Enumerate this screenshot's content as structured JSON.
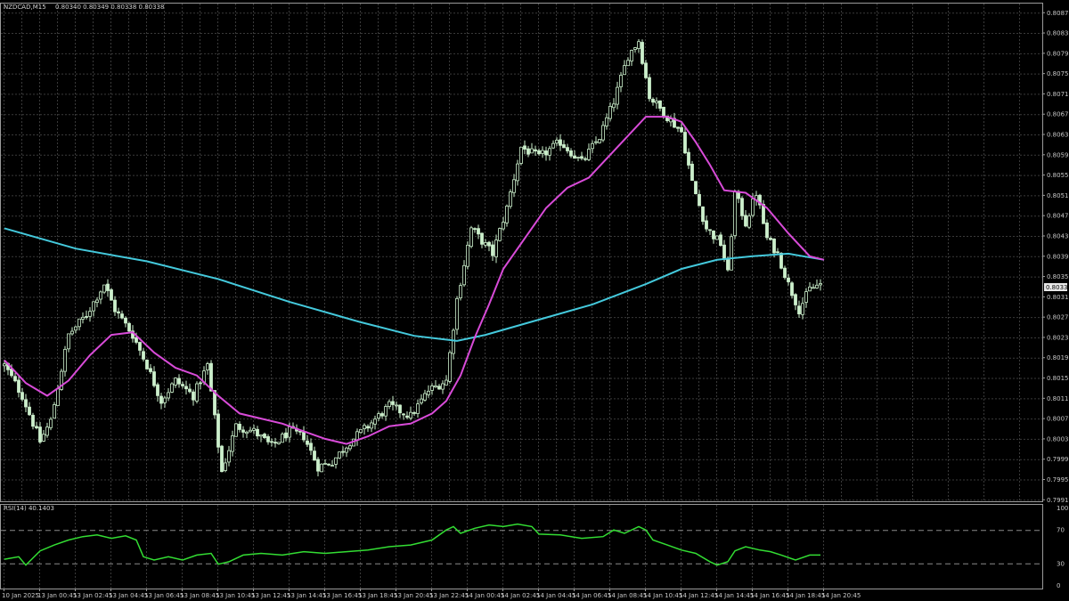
{
  "header": {
    "symbol_info": "NZDCAD,M15",
    "ohlc": "0.80340 0.80349 0.80338 0.80338"
  },
  "rsi_header": "RSI(14) 40.1403",
  "current_price_label": "0.80338",
  "colors": {
    "background": "#000000",
    "grid": "#3a3a3a",
    "frame": "#9a9a9a",
    "candle": "#ccf0cc",
    "ma_fast": "#d84bd8",
    "ma_slow": "#44c9dc",
    "rsi": "#33dd33"
  },
  "chart_data": {
    "type": "candlestick",
    "price_axis_ticks": [
      "0.80875",
      "0.80835",
      "0.80795",
      "0.80755",
      "0.80715",
      "0.80675",
      "0.80635",
      "0.80595",
      "0.80555",
      "0.80515",
      "0.80475",
      "0.80435",
      "0.80395",
      "0.80355",
      "0.80315",
      "0.80275",
      "0.80235",
      "0.80195",
      "0.80155",
      "0.80115",
      "0.80075",
      "0.80035",
      "0.79995",
      "0.79955",
      "0.79915"
    ],
    "ylim": [
      0.79912,
      0.80893
    ],
    "time_axis_ticks": [
      "10 Jan 2025",
      "13 Jan 00:45",
      "13 Jan 02:45",
      "13 Jan 04:45",
      "13 Jan 06:45",
      "13 Jan 08:45",
      "13 Jan 10:45",
      "13 Jan 12:45",
      "13 Jan 14:45",
      "13 Jan 16:45",
      "13 Jan 18:45",
      "13 Jan 20:45",
      "13 Jan 22:45",
      "14 Jan 00:45",
      "14 Jan 02:45",
      "14 Jan 04:45",
      "14 Jan 06:45",
      "14 Jan 08:45",
      "14 Jan 10:45",
      "14 Jan 12:45",
      "14 Jan 14:45",
      "14 Jan 16:45",
      "14 Jan 18:45",
      "14 Jan 20:45"
    ],
    "bars": 230,
    "close_path": [
      [
        0,
        0.8018
      ],
      [
        5,
        0.8012
      ],
      [
        10,
        0.8003
      ],
      [
        13,
        0.8007
      ],
      [
        18,
        0.8024
      ],
      [
        23,
        0.8028
      ],
      [
        28,
        0.8034
      ],
      [
        31,
        0.8029
      ],
      [
        36,
        0.8024
      ],
      [
        40,
        0.8018
      ],
      [
        44,
        0.8011
      ],
      [
        48,
        0.8015
      ],
      [
        53,
        0.8012
      ],
      [
        57,
        0.8018
      ],
      [
        61,
        0.7997
      ],
      [
        65,
        0.8006
      ],
      [
        70,
        0.8005
      ],
      [
        75,
        0.8002
      ],
      [
        80,
        0.8005
      ],
      [
        84,
        0.8004
      ],
      [
        88,
        0.7998
      ],
      [
        92,
        0.7999
      ],
      [
        97,
        0.8003
      ],
      [
        102,
        0.8006
      ],
      [
        108,
        0.801
      ],
      [
        114,
        0.8008
      ],
      [
        119,
        0.8013
      ],
      [
        124,
        0.8015
      ],
      [
        127,
        0.8031
      ],
      [
        131,
        0.8045
      ],
      [
        137,
        0.804
      ],
      [
        141,
        0.8049
      ],
      [
        145,
        0.8061
      ],
      [
        150,
        0.8059
      ],
      [
        156,
        0.8062
      ],
      [
        162,
        0.8058
      ],
      [
        167,
        0.8063
      ],
      [
        171,
        0.807
      ],
      [
        175,
        0.8079
      ],
      [
        178,
        0.8082
      ],
      [
        181,
        0.8071
      ],
      [
        186,
        0.8067
      ],
      [
        190,
        0.8064
      ],
      [
        193,
        0.8054
      ],
      [
        197,
        0.8045
      ],
      [
        201,
        0.8042
      ],
      [
        203,
        0.8036
      ],
      [
        205,
        0.8052
      ],
      [
        208,
        0.8046
      ],
      [
        211,
        0.8052
      ],
      [
        214,
        0.8043
      ],
      [
        217,
        0.804
      ],
      [
        220,
        0.8034
      ],
      [
        223,
        0.8029
      ],
      [
        226,
        0.8033
      ],
      [
        229,
        0.8034
      ]
    ],
    "ma_fast_path": [
      [
        0,
        0.8019
      ],
      [
        6,
        0.80145
      ],
      [
        12,
        0.8012
      ],
      [
        18,
        0.8015
      ],
      [
        24,
        0.802
      ],
      [
        30,
        0.8024
      ],
      [
        36,
        0.80245
      ],
      [
        42,
        0.80205
      ],
      [
        48,
        0.80175
      ],
      [
        54,
        0.8016
      ],
      [
        60,
        0.8012
      ],
      [
        66,
        0.80085
      ],
      [
        72,
        0.80075
      ],
      [
        78,
        0.80065
      ],
      [
        84,
        0.8005
      ],
      [
        90,
        0.80035
      ],
      [
        96,
        0.80025
      ],
      [
        102,
        0.8004
      ],
      [
        108,
        0.8006
      ],
      [
        114,
        0.80065
      ],
      [
        120,
        0.80085
      ],
      [
        124,
        0.8011
      ],
      [
        128,
        0.8016
      ],
      [
        132,
        0.80235
      ],
      [
        136,
        0.803
      ],
      [
        140,
        0.8037
      ],
      [
        146,
        0.8043
      ],
      [
        152,
        0.8049
      ],
      [
        158,
        0.8053
      ],
      [
        164,
        0.8055
      ],
      [
        168,
        0.8058
      ],
      [
        172,
        0.8061
      ],
      [
        176,
        0.8064
      ],
      [
        180,
        0.8067
      ],
      [
        186,
        0.8067
      ],
      [
        190,
        0.8066
      ],
      [
        194,
        0.8062
      ],
      [
        198,
        0.80575
      ],
      [
        202,
        0.80525
      ],
      [
        208,
        0.8052
      ],
      [
        214,
        0.8049
      ],
      [
        220,
        0.8044
      ],
      [
        226,
        0.80395
      ],
      [
        230,
        0.80388
      ]
    ],
    "ma_slow_path": [
      [
        0,
        0.8045
      ],
      [
        20,
        0.8041
      ],
      [
        40,
        0.80385
      ],
      [
        60,
        0.8035
      ],
      [
        80,
        0.80305
      ],
      [
        100,
        0.80265
      ],
      [
        115,
        0.80238
      ],
      [
        127,
        0.80228
      ],
      [
        135,
        0.8024
      ],
      [
        150,
        0.8027
      ],
      [
        165,
        0.803
      ],
      [
        180,
        0.8034
      ],
      [
        190,
        0.8037
      ],
      [
        200,
        0.80388
      ],
      [
        210,
        0.80395
      ],
      [
        220,
        0.804
      ],
      [
        230,
        0.80388
      ]
    ],
    "rsi": {
      "ticks": [
        "100",
        "70",
        "30",
        "0"
      ],
      "levels": [
        70,
        30
      ],
      "ylim": [
        0,
        100
      ],
      "path": [
        [
          0,
          35
        ],
        [
          4,
          38
        ],
        [
          6,
          28
        ],
        [
          10,
          45
        ],
        [
          14,
          52
        ],
        [
          18,
          58
        ],
        [
          22,
          62
        ],
        [
          26,
          64
        ],
        [
          30,
          60
        ],
        [
          34,
          63
        ],
        [
          37,
          58
        ],
        [
          39,
          38
        ],
        [
          42,
          34
        ],
        [
          46,
          38
        ],
        [
          50,
          34
        ],
        [
          54,
          40
        ],
        [
          58,
          42
        ],
        [
          60,
          29
        ],
        [
          63,
          32
        ],
        [
          67,
          40
        ],
        [
          72,
          42
        ],
        [
          78,
          40
        ],
        [
          84,
          44
        ],
        [
          90,
          42
        ],
        [
          96,
          44
        ],
        [
          102,
          46
        ],
        [
          108,
          50
        ],
        [
          114,
          52
        ],
        [
          120,
          58
        ],
        [
          124,
          70
        ],
        [
          126,
          74
        ],
        [
          128,
          66
        ],
        [
          132,
          72
        ],
        [
          136,
          76
        ],
        [
          140,
          74
        ],
        [
          144,
          77
        ],
        [
          148,
          74
        ],
        [
          150,
          65
        ],
        [
          156,
          64
        ],
        [
          162,
          60
        ],
        [
          168,
          62
        ],
        [
          171,
          70
        ],
        [
          174,
          66
        ],
        [
          178,
          74
        ],
        [
          180,
          70
        ],
        [
          182,
          58
        ],
        [
          186,
          52
        ],
        [
          190,
          46
        ],
        [
          194,
          42
        ],
        [
          198,
          32
        ],
        [
          200,
          28
        ],
        [
          203,
          32
        ],
        [
          205,
          45
        ],
        [
          208,
          50
        ],
        [
          212,
          46
        ],
        [
          215,
          44
        ],
        [
          218,
          40
        ],
        [
          222,
          34
        ],
        [
          226,
          40
        ],
        [
          229,
          40
        ]
      ]
    }
  }
}
